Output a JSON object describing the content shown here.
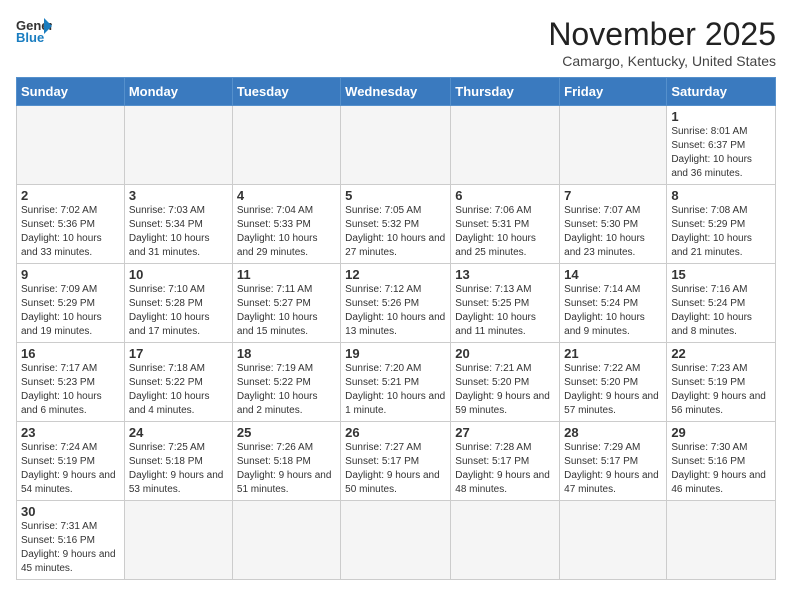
{
  "header": {
    "logo_general": "General",
    "logo_blue": "Blue",
    "month_title": "November 2025",
    "location": "Camargo, Kentucky, United States"
  },
  "days_of_week": [
    "Sunday",
    "Monday",
    "Tuesday",
    "Wednesday",
    "Thursday",
    "Friday",
    "Saturday"
  ],
  "weeks": [
    [
      {
        "day": "",
        "info": ""
      },
      {
        "day": "",
        "info": ""
      },
      {
        "day": "",
        "info": ""
      },
      {
        "day": "",
        "info": ""
      },
      {
        "day": "",
        "info": ""
      },
      {
        "day": "",
        "info": ""
      },
      {
        "day": "1",
        "info": "Sunrise: 8:01 AM\nSunset: 6:37 PM\nDaylight: 10 hours and 36 minutes."
      }
    ],
    [
      {
        "day": "2",
        "info": "Sunrise: 7:02 AM\nSunset: 5:36 PM\nDaylight: 10 hours and 33 minutes."
      },
      {
        "day": "3",
        "info": "Sunrise: 7:03 AM\nSunset: 5:34 PM\nDaylight: 10 hours and 31 minutes."
      },
      {
        "day": "4",
        "info": "Sunrise: 7:04 AM\nSunset: 5:33 PM\nDaylight: 10 hours and 29 minutes."
      },
      {
        "day": "5",
        "info": "Sunrise: 7:05 AM\nSunset: 5:32 PM\nDaylight: 10 hours and 27 minutes."
      },
      {
        "day": "6",
        "info": "Sunrise: 7:06 AM\nSunset: 5:31 PM\nDaylight: 10 hours and 25 minutes."
      },
      {
        "day": "7",
        "info": "Sunrise: 7:07 AM\nSunset: 5:30 PM\nDaylight: 10 hours and 23 minutes."
      },
      {
        "day": "8",
        "info": "Sunrise: 7:08 AM\nSunset: 5:29 PM\nDaylight: 10 hours and 21 minutes."
      }
    ],
    [
      {
        "day": "9",
        "info": "Sunrise: 7:09 AM\nSunset: 5:29 PM\nDaylight: 10 hours and 19 minutes."
      },
      {
        "day": "10",
        "info": "Sunrise: 7:10 AM\nSunset: 5:28 PM\nDaylight: 10 hours and 17 minutes."
      },
      {
        "day": "11",
        "info": "Sunrise: 7:11 AM\nSunset: 5:27 PM\nDaylight: 10 hours and 15 minutes."
      },
      {
        "day": "12",
        "info": "Sunrise: 7:12 AM\nSunset: 5:26 PM\nDaylight: 10 hours and 13 minutes."
      },
      {
        "day": "13",
        "info": "Sunrise: 7:13 AM\nSunset: 5:25 PM\nDaylight: 10 hours and 11 minutes."
      },
      {
        "day": "14",
        "info": "Sunrise: 7:14 AM\nSunset: 5:24 PM\nDaylight: 10 hours and 9 minutes."
      },
      {
        "day": "15",
        "info": "Sunrise: 7:16 AM\nSunset: 5:24 PM\nDaylight: 10 hours and 8 minutes."
      }
    ],
    [
      {
        "day": "16",
        "info": "Sunrise: 7:17 AM\nSunset: 5:23 PM\nDaylight: 10 hours and 6 minutes."
      },
      {
        "day": "17",
        "info": "Sunrise: 7:18 AM\nSunset: 5:22 PM\nDaylight: 10 hours and 4 minutes."
      },
      {
        "day": "18",
        "info": "Sunrise: 7:19 AM\nSunset: 5:22 PM\nDaylight: 10 hours and 2 minutes."
      },
      {
        "day": "19",
        "info": "Sunrise: 7:20 AM\nSunset: 5:21 PM\nDaylight: 10 hours and 1 minute."
      },
      {
        "day": "20",
        "info": "Sunrise: 7:21 AM\nSunset: 5:20 PM\nDaylight: 9 hours and 59 minutes."
      },
      {
        "day": "21",
        "info": "Sunrise: 7:22 AM\nSunset: 5:20 PM\nDaylight: 9 hours and 57 minutes."
      },
      {
        "day": "22",
        "info": "Sunrise: 7:23 AM\nSunset: 5:19 PM\nDaylight: 9 hours and 56 minutes."
      }
    ],
    [
      {
        "day": "23",
        "info": "Sunrise: 7:24 AM\nSunset: 5:19 PM\nDaylight: 9 hours and 54 minutes."
      },
      {
        "day": "24",
        "info": "Sunrise: 7:25 AM\nSunset: 5:18 PM\nDaylight: 9 hours and 53 minutes."
      },
      {
        "day": "25",
        "info": "Sunrise: 7:26 AM\nSunset: 5:18 PM\nDaylight: 9 hours and 51 minutes."
      },
      {
        "day": "26",
        "info": "Sunrise: 7:27 AM\nSunset: 5:17 PM\nDaylight: 9 hours and 50 minutes."
      },
      {
        "day": "27",
        "info": "Sunrise: 7:28 AM\nSunset: 5:17 PM\nDaylight: 9 hours and 48 minutes."
      },
      {
        "day": "28",
        "info": "Sunrise: 7:29 AM\nSunset: 5:17 PM\nDaylight: 9 hours and 47 minutes."
      },
      {
        "day": "29",
        "info": "Sunrise: 7:30 AM\nSunset: 5:16 PM\nDaylight: 9 hours and 46 minutes."
      }
    ],
    [
      {
        "day": "30",
        "info": "Sunrise: 7:31 AM\nSunset: 5:16 PM\nDaylight: 9 hours and 45 minutes."
      },
      {
        "day": "",
        "info": ""
      },
      {
        "day": "",
        "info": ""
      },
      {
        "day": "",
        "info": ""
      },
      {
        "day": "",
        "info": ""
      },
      {
        "day": "",
        "info": ""
      },
      {
        "day": "",
        "info": ""
      }
    ]
  ]
}
